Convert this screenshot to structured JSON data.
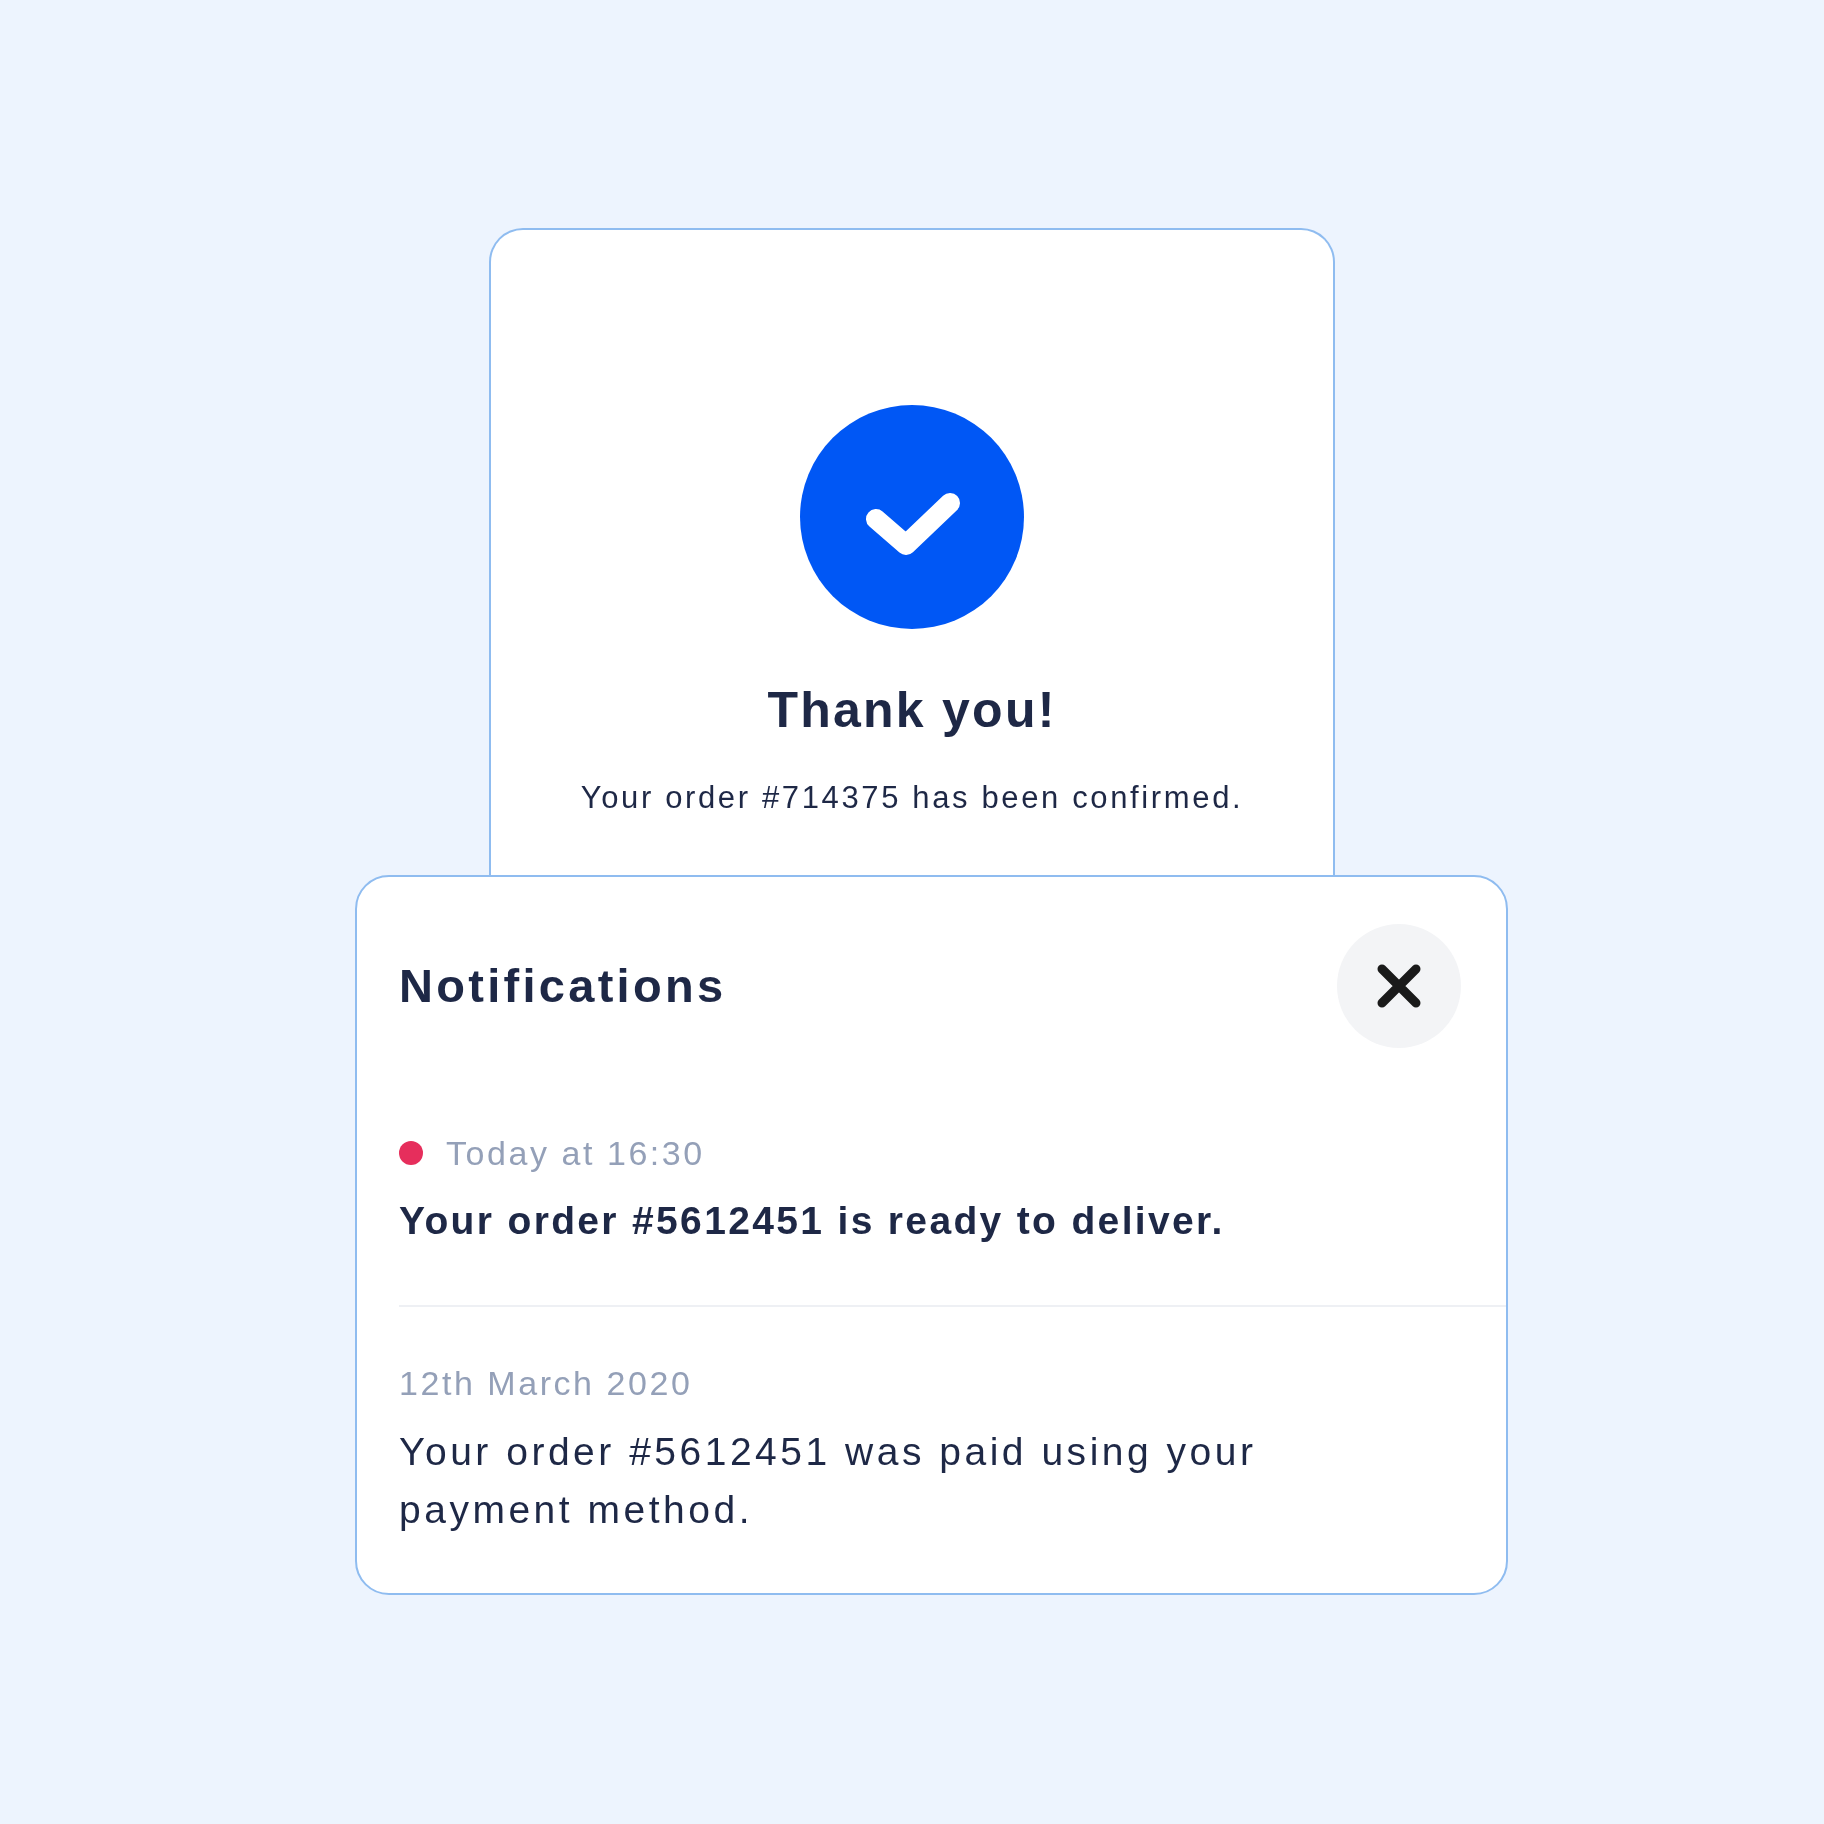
{
  "confirmation": {
    "title": "Thank you!",
    "message": "Your order #714375 has been confirmed."
  },
  "notifications": {
    "title": "Notifications",
    "items": [
      {
        "time": "Today at 16:30",
        "unread": true,
        "text": "Your order #5612451 is ready to deliver."
      },
      {
        "time": "12th March 2020",
        "unread": false,
        "text": "Your order #5612451 was paid using your payment method."
      }
    ]
  }
}
